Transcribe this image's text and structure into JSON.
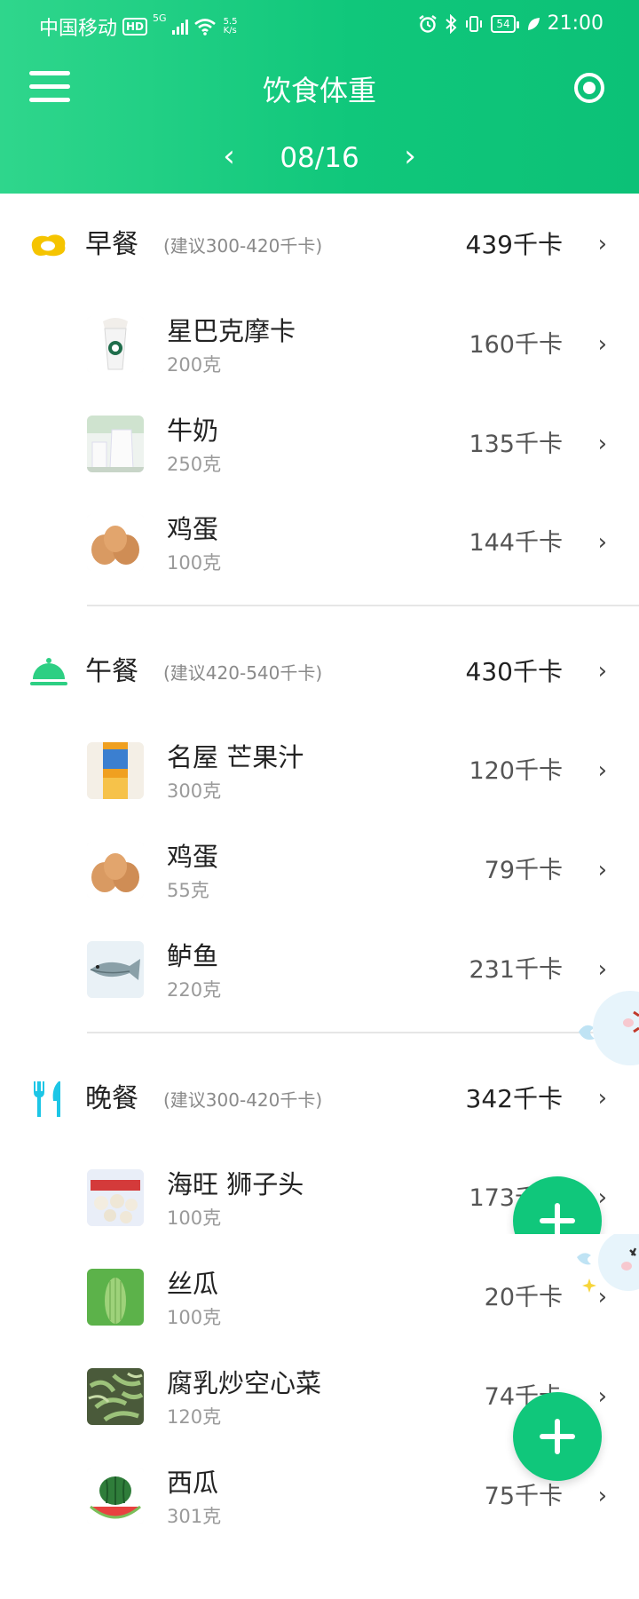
{
  "status_bar": {
    "carrier": "中国移动",
    "hd_badge": "HD",
    "network_type": "5G",
    "net_speed_value": "5.5",
    "net_speed_unit": "K/s",
    "battery": "54",
    "time": "21:00"
  },
  "header": {
    "title": "饮食体重",
    "date": "08/16",
    "prev_symbol": "‹",
    "next_symbol": "›"
  },
  "colors": {
    "header_green": "#10c77b",
    "breakfast_icon": "#f5c400",
    "lunch_icon": "#2dcf83",
    "dinner_icon": "#1cc6e6"
  },
  "meals": [
    {
      "name": "早餐",
      "icon": "fried-egg-icon",
      "suggestion": "(建议300-420千卡)",
      "total": "439千卡",
      "foods": [
        {
          "name": "星巴克摩卡",
          "weight": "200克",
          "kcal": "160千卡",
          "thumb": "starbucks-cup"
        },
        {
          "name": "牛奶",
          "weight": "250克",
          "kcal": "135千卡",
          "thumb": "milk"
        },
        {
          "name": "鸡蛋",
          "weight": "100克",
          "kcal": "144千卡",
          "thumb": "eggs"
        }
      ]
    },
    {
      "name": "午餐",
      "icon": "cloche-icon",
      "suggestion": "(建议420-540千卡)",
      "total": "430千卡",
      "foods": [
        {
          "name": "名屋 芒果汁",
          "weight": "300克",
          "kcal": "120千卡",
          "thumb": "mango-juice"
        },
        {
          "name": "鸡蛋",
          "weight": "55克",
          "kcal": "79千卡",
          "thumb": "eggs"
        },
        {
          "name": "鲈鱼",
          "weight": "220克",
          "kcal": "231千卡",
          "thumb": "fish"
        }
      ]
    },
    {
      "name": "晚餐",
      "icon": "fork-knife-icon",
      "suggestion": "(建议300-420千卡)",
      "total": "342千卡",
      "foods": [
        {
          "name": "海旺 狮子头",
          "weight": "100克",
          "kcal": "173千卡",
          "thumb": "meatballs"
        },
        {
          "name": "丝瓜",
          "weight": "100克",
          "kcal": "20千卡",
          "thumb": "loofah"
        },
        {
          "name": "腐乳炒空心菜",
          "weight": "120克",
          "kcal": "74千卡",
          "thumb": "greens"
        },
        {
          "name": "西瓜",
          "weight": "301克",
          "kcal": "75千卡",
          "thumb": "watermelon"
        }
      ]
    }
  ],
  "chevron_symbol": "›"
}
